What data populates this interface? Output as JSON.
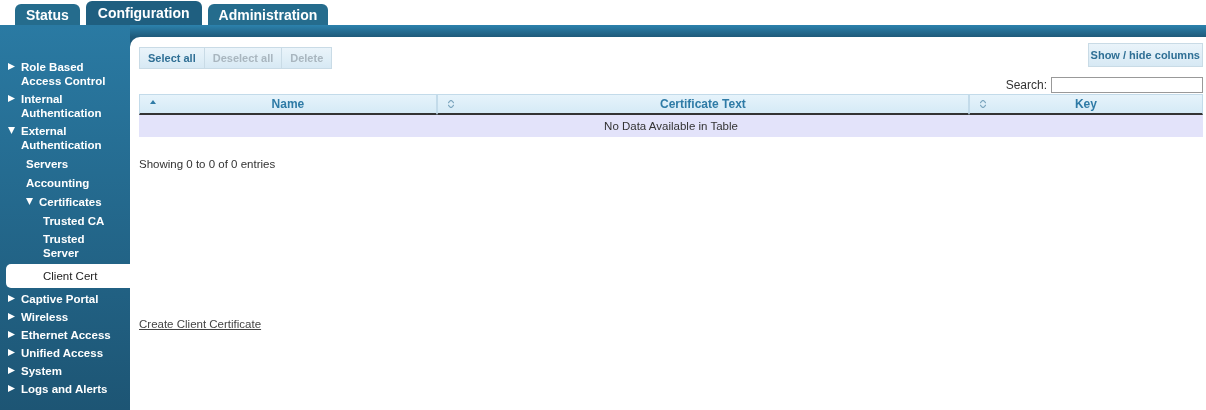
{
  "tabs": [
    {
      "label": "Status",
      "selected": false
    },
    {
      "label": "Configuration",
      "selected": true
    },
    {
      "label": "Administration",
      "selected": false
    }
  ],
  "sidebar": {
    "items": [
      {
        "label": "Role Based Access Control",
        "expanded": false,
        "selected": false
      },
      {
        "label": "Internal Authentication",
        "expanded": false,
        "selected": false
      },
      {
        "label": "External Authentication",
        "expanded": true,
        "selected": false,
        "children": [
          {
            "label": "Servers",
            "selected": false
          },
          {
            "label": "Accounting",
            "selected": false
          },
          {
            "label": "Certificates",
            "expanded": true,
            "selected": false,
            "children": [
              {
                "label": "Trusted CA",
                "selected": false
              },
              {
                "label": "Trusted Server",
                "selected": false
              },
              {
                "label": "Client Cert",
                "selected": true
              }
            ]
          }
        ]
      },
      {
        "label": "Captive Portal",
        "expanded": false,
        "selected": false
      },
      {
        "label": "Wireless",
        "expanded": false,
        "selected": false
      },
      {
        "label": "Ethernet Access",
        "expanded": false,
        "selected": false
      },
      {
        "label": "Unified Access",
        "expanded": false,
        "selected": false
      },
      {
        "label": "System",
        "expanded": false,
        "selected": false
      },
      {
        "label": "Logs and Alerts",
        "expanded": false,
        "selected": false
      }
    ]
  },
  "toolbar": [
    {
      "label": "Select all",
      "disabled": false
    },
    {
      "label": "Deselect all",
      "disabled": true
    },
    {
      "label": "Delete",
      "disabled": true
    }
  ],
  "column_toggle": "Show / hide columns",
  "search": {
    "label": "Search:"
  },
  "table": {
    "columns": [
      {
        "label": "Name",
        "sorted": true
      },
      {
        "label": "Certificate Text",
        "sorted": false
      },
      {
        "label": "Key",
        "sorted": false
      }
    ],
    "empty_message": "No Data Available in Table"
  },
  "info": "Showing 0 to 0 of 0 entries",
  "create_link": "Create Client Certificate"
}
